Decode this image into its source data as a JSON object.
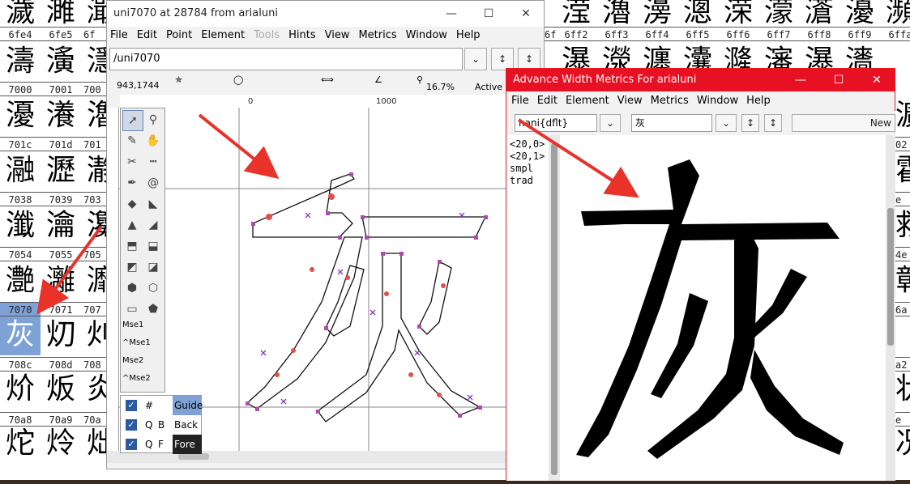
{
  "background_grid": {
    "hex_rows_left": [
      [
        "6fe4",
        "6fe5"
      ],
      [
        "7000",
        "7001"
      ],
      [
        "701c",
        "701d"
      ],
      [
        "7038",
        "7039"
      ],
      [
        "7054",
        "7055"
      ],
      [
        "7070",
        "7071"
      ],
      [
        "708c",
        "708d"
      ],
      [
        "70a8",
        "70a9"
      ]
    ],
    "glyph_rows_left": [
      [
        "濊",
        "濉",
        "濈"
      ],
      [
        "濤",
        "濥",
        "濦"
      ],
      [
        "瀀",
        "瀁",
        "瀂"
      ],
      [
        "瀜",
        "瀝",
        "瀞"
      ],
      [
        "瀸",
        "瀹",
        "瀺"
      ],
      [
        "灔",
        "灕",
        "灖"
      ],
      [
        "灰",
        "灱",
        "灲"
      ],
      [
        "炌",
        "炍",
        "炎"
      ],
      [
        "炨",
        "炩",
        "炪"
      ]
    ],
    "partial_hex_left3": [
      "6f",
      "700",
      "701",
      "703",
      "705",
      "707",
      "708",
      "70a"
    ],
    "hex_row_right": [
      "6ff2",
      "6ff3",
      "6ff4",
      "6ff5",
      "6ff6",
      "6ff7",
      "6ff8",
      "6ff9",
      "6ffa"
    ],
    "partial_hex_left_of_right": "6ff1",
    "glyph_row_right_top": [
      "滢",
      "瀂",
      "澷",
      "漗",
      "溁",
      "濛",
      "濸",
      "瀀",
      "瀕"
    ],
    "glyph_row_right_2": [
      "瀑",
      "濴",
      "瀍",
      "灢",
      "漋",
      "瀋",
      "瀑",
      "瀒"
    ],
    "right_edge_hex": [
      "02",
      "e",
      "4e",
      "6a",
      "a2",
      "e"
    ],
    "right_edge_glyphs": [
      "瀇",
      "霍",
      "救",
      "彰",
      "状",
      "况"
    ],
    "selected_hex": "7070",
    "selected_glyph": "灰"
  },
  "editor": {
    "title": "uni7070 at 28784 from arialuni",
    "menu": [
      "File",
      "Edit",
      "Point",
      "Element",
      "Tools",
      "Hints",
      "View",
      "Metrics",
      "Window",
      "Help"
    ],
    "disabled_menu": "Tools",
    "glyph_name_field": "/uni7070",
    "status": {
      "coords": "943,1744",
      "zoom": "16.7%",
      "active_layer": "Active L"
    },
    "ruler_labels": [
      "0",
      "1000"
    ],
    "palette_mouse_labels": [
      "Mse1",
      "^Mse1",
      "Mse2",
      "^Mse2"
    ],
    "layers": [
      {
        "sym1": "#",
        "sym2": "",
        "name": "Guide"
      },
      {
        "sym1": "Q",
        "sym2": "B",
        "name": "Back"
      },
      {
        "sym1": "Q",
        "sym2": "F",
        "name": "Fore"
      }
    ],
    "vertical_ruler": [
      "2",
      "0",
      "0",
      "1",
      "0",
      "0",
      "0"
    ]
  },
  "metrics_window": {
    "title": "Advance Width Metrics For arialuni",
    "menu": [
      "File",
      "Edit",
      "Element",
      "View",
      "Metrics",
      "Window",
      "Help"
    ],
    "script_field": "hani{dflt}",
    "text_field": "灰",
    "new_button": "New",
    "features": [
      "<20,0>",
      "<20,1>",
      "smpl",
      "trad"
    ],
    "glyph": "灰"
  },
  "colors": {
    "metrics_title_bg": "#e81123",
    "selection": "#7ea2d6",
    "annotation_arrow": "#e8322a",
    "outline": "#000000",
    "point_magenta": "#b04ab0",
    "point_red": "#e0504a"
  },
  "icons": [
    "minimize-icon",
    "maximize-icon",
    "close-icon",
    "pointer-icon",
    "magnify-icon",
    "pencil-icon",
    "hand-icon",
    "knife-icon",
    "ruler-icon",
    "pen-icon",
    "spiro-icon",
    "curve-point-icon",
    "corner-point-icon",
    "tangent-point-icon",
    "hv-curve-icon",
    "scale-icon",
    "rotate-icon",
    "flip-icon",
    "skew-icon",
    "3d-rotate-icon",
    "perspective-icon",
    "rectangle-icon",
    "polygon-icon",
    "dropdown-icon",
    "stepper-icon"
  ]
}
